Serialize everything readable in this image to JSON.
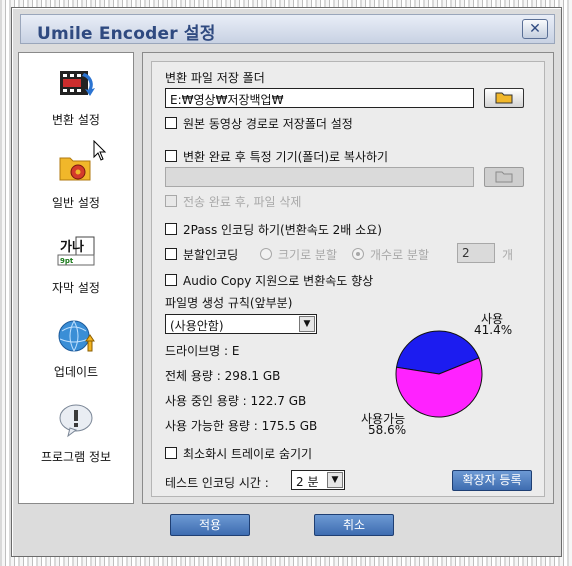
{
  "window": {
    "title": "Umile Encoder 설정",
    "close_glyph": "✕"
  },
  "sidebar": {
    "items": [
      {
        "label": "변환 설정",
        "icon": "film-convert-icon"
      },
      {
        "label": "일반 설정",
        "icon": "folder-gear-icon"
      },
      {
        "label": "자막 설정",
        "icon": "subtitle-icon"
      },
      {
        "label": "업데이트",
        "icon": "globe-update-icon"
      },
      {
        "label": "프로그램 정보",
        "icon": "info-bubble-icon"
      }
    ]
  },
  "settings": {
    "save_folder_label": "변환 파일 저장 폴더",
    "save_folder_path": "E:₩영상₩저장백업₩",
    "original_path_label": "원본 동영상 경로로 저장폴더 설정",
    "copy_to_device_label": "변환 완료 후 특정 기기(폴더)로 복사하기",
    "copy_path": "",
    "delete_after_label": "전송 완료 후, 파일 삭제",
    "two_pass_label": "2Pass 인코딩 하기(변환속도 2배 소요)",
    "split_label": "분할인코딩",
    "split_by_size_label": "크기로 분할",
    "split_by_count_label": "개수로 분할",
    "split_count": "2",
    "split_unit": "개",
    "audio_copy_label": "Audio Copy 지원으로 변환속도 향상",
    "filename_rule_label": "파일명 생성 규칙(앞부분)",
    "filename_rule_value": "(사용안함)",
    "drive_name": "드라이브명 : E",
    "total_capacity": "전체 용량 : 298.1 GB",
    "used_capacity": "사용 중인 용량 : 122.7 GB",
    "free_capacity": "사용 가능한 용량 : 175.5 GB",
    "minimize_tray_label": "최소화시 트레이로 숨기기",
    "test_encoding_label": "테스트 인코딩 시간 :",
    "test_encoding_value": "2 분",
    "register_ext_button": "확장자 등록"
  },
  "chart_data": {
    "type": "pie",
    "slices": [
      {
        "label": "사용",
        "percent_label": "41.4%",
        "value": 41.4,
        "color": "#1c1cf0"
      },
      {
        "label": "사용가능",
        "percent_label": "58.6%",
        "value": 58.6,
        "color": "#ff22ff"
      }
    ]
  },
  "footer": {
    "ok_label": "적용",
    "cancel_label": "취소"
  }
}
